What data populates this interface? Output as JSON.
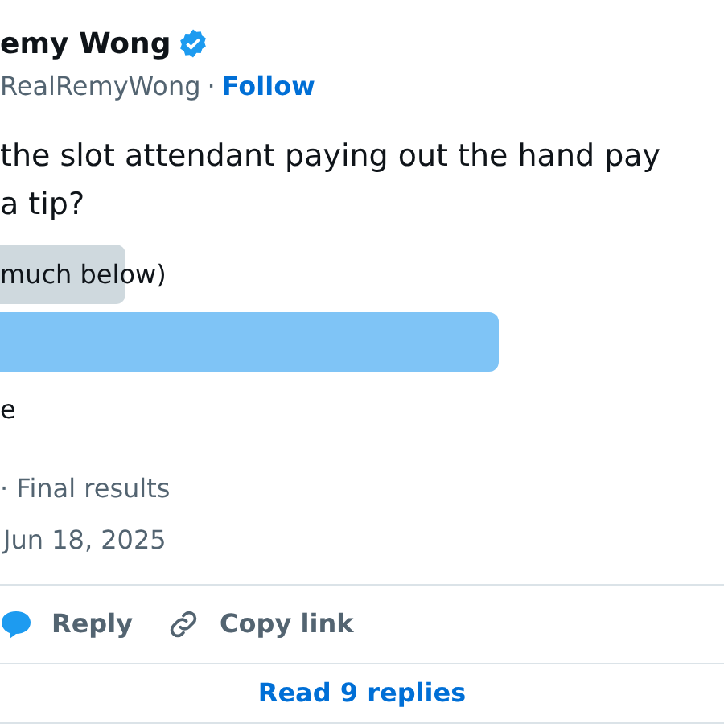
{
  "author": {
    "name": "emy Wong",
    "verified": true,
    "handle": "RealRemyWong",
    "separator": "·",
    "follow": "Follow"
  },
  "text_lines": [
    "the slot attendant paying out the hand pay",
    "a tip?"
  ],
  "poll": {
    "options": [
      {
        "label": "much below)",
        "leading": false,
        "bar": true
      },
      {
        "leading": true,
        "bar": true
      },
      {
        "label": "e",
        "leading": false,
        "bar": false
      }
    ],
    "status": "· Final results"
  },
  "date": "Jun 18, 2025",
  "actions": [
    {
      "kind": "reply",
      "label": "Reply"
    },
    {
      "kind": "copy",
      "label": "Copy link"
    }
  ],
  "read_replies": "Read 9 replies"
}
